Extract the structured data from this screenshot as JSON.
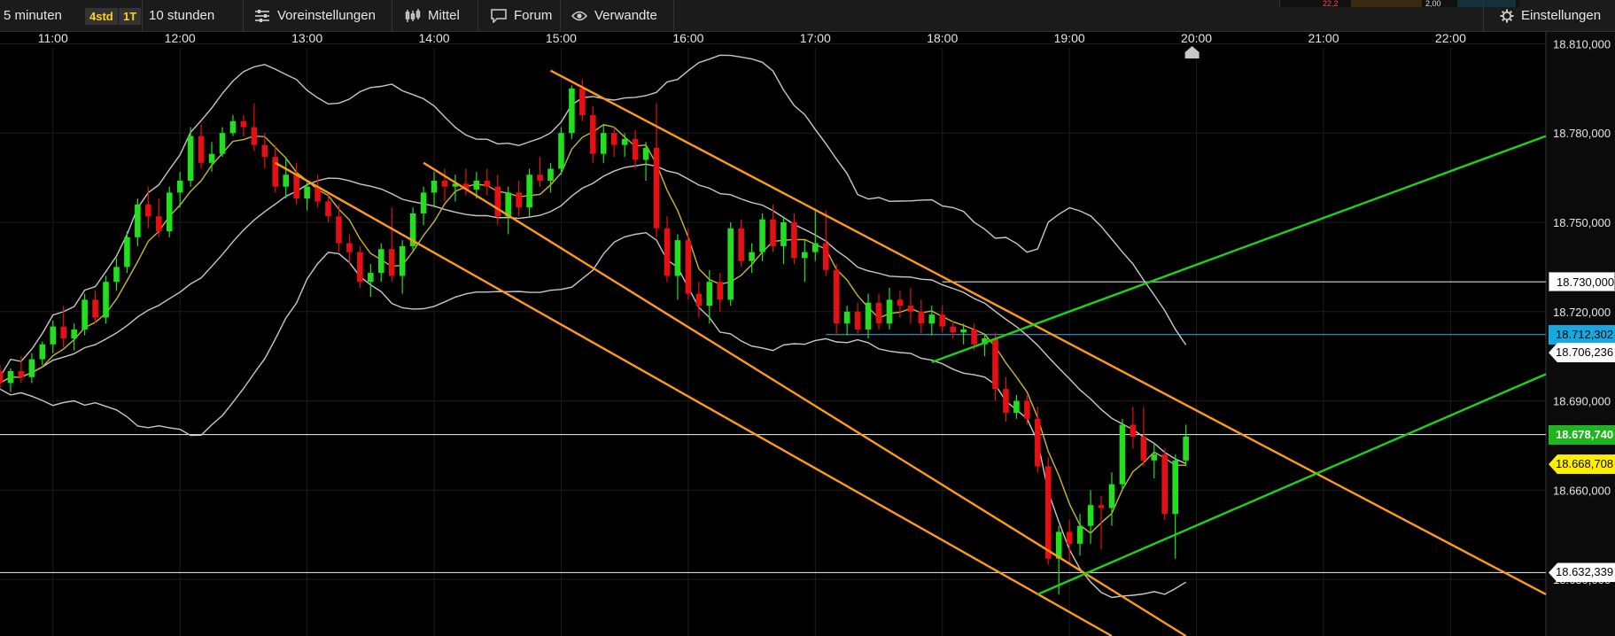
{
  "toolbar": {
    "interval": "5 minuten",
    "chip_range": "4std",
    "chip_day": "1T",
    "range": "10 stunden",
    "presets": "Voreinstellungen",
    "indicators": "Mittel",
    "forum": "Forum",
    "related": "Verwandte",
    "settings": "Einstellungen",
    "strip_red": "22,2",
    "strip_val": "2,00",
    "icons": [
      "sliders-icon",
      "candle-chart-icon",
      "speech-bubble-icon",
      "eye-icon",
      "gear-icon"
    ]
  },
  "colors": {
    "up": "#22e01e",
    "down": "#e60f14",
    "orange": "#ff9a1a",
    "green": "#1ed219",
    "bollinger": "#c8c8c8",
    "sma": "#c7b830",
    "blue_line": "#1ba0d4",
    "last_price_box": "#1fb51f",
    "yellow_box": "#ffee00",
    "blue_box": "#18a8e0"
  },
  "chart_data": {
    "type": "candlestick",
    "x_ticks": [
      "11:00",
      "12:00",
      "13:00",
      "14:00",
      "15:00",
      "16:00",
      "17:00",
      "18:00",
      "19:00",
      "20:00",
      "21:00",
      "22:00"
    ],
    "y_ticks": [
      "18.810,000",
      "18.780,000",
      "18.750,000",
      "18.720,000",
      "18.690,000",
      "18.660,000",
      "18.630,000"
    ],
    "y_tick_values": [
      18810,
      18780,
      18750,
      18720,
      18690,
      18660,
      18630
    ],
    "x_start": "10:35",
    "x_end": "22:45",
    "y_range": [
      18611,
      18814
    ],
    "markers": [
      {
        "label": "18.730,000",
        "value": 18730,
        "style": "white"
      },
      {
        "label": "18.712,302",
        "value": 18712.3,
        "style": "blue"
      },
      {
        "label": "18.706,236",
        "value": 18706.2,
        "style": "white-tag"
      },
      {
        "label": "18.678,740",
        "value": 18678.7,
        "style": "green"
      },
      {
        "label": "18.668,708",
        "value": 18668.7,
        "style": "yellow"
      },
      {
        "label": "18.632,339",
        "value": 18632.3,
        "style": "white-tag"
      }
    ],
    "horizontal_lines": [
      {
        "value": 18730,
        "from": "18:00",
        "color": "white"
      },
      {
        "value": 18712.3,
        "from": "17:05",
        "color": "blue"
      },
      {
        "value": 18678.7,
        "from": "10:35",
        "color": "white"
      },
      {
        "value": 18632.3,
        "from": "10:35",
        "color": "white"
      }
    ],
    "trend_lines": [
      {
        "color": "orange",
        "from": [
          "14:55",
          18801
        ],
        "to": [
          "22:45",
          18625
        ]
      },
      {
        "color": "orange",
        "from": [
          "12:45",
          18770
        ],
        "to": [
          "19:20",
          18611
        ]
      },
      {
        "color": "orange",
        "from": [
          "13:55",
          18770
        ],
        "to": [
          "19:55",
          18611
        ]
      },
      {
        "color": "green",
        "from": [
          "17:55",
          18703
        ],
        "to": [
          "22:45",
          18779
        ]
      },
      {
        "color": "green",
        "from": [
          "18:45",
          18625
        ],
        "to": [
          "22:45",
          18699
        ]
      }
    ],
    "candles": [
      {
        "t": "10:35",
        "o": 18700,
        "h": 18702,
        "l": 18694,
        "c": 18696
      },
      {
        "t": "10:40",
        "o": 18696,
        "h": 18701,
        "l": 18693,
        "c": 18700
      },
      {
        "t": "10:45",
        "o": 18700,
        "h": 18705,
        "l": 18696,
        "c": 18698
      },
      {
        "t": "10:50",
        "o": 18698,
        "h": 18706,
        "l": 18696,
        "c": 18704
      },
      {
        "t": "10:55",
        "o": 18704,
        "h": 18710,
        "l": 18702,
        "c": 18709
      },
      {
        "t": "11:00",
        "o": 18709,
        "h": 18717,
        "l": 18706,
        "c": 18715
      },
      {
        "t": "11:05",
        "o": 18715,
        "h": 18722,
        "l": 18708,
        "c": 18711
      },
      {
        "t": "11:10",
        "o": 18711,
        "h": 18716,
        "l": 18707,
        "c": 18714
      },
      {
        "t": "11:15",
        "o": 18714,
        "h": 18726,
        "l": 18712,
        "c": 18724
      },
      {
        "t": "11:20",
        "o": 18724,
        "h": 18727,
        "l": 18716,
        "c": 18718
      },
      {
        "t": "11:25",
        "o": 18718,
        "h": 18732,
        "l": 18716,
        "c": 18730
      },
      {
        "t": "11:30",
        "o": 18730,
        "h": 18738,
        "l": 18727,
        "c": 18735
      },
      {
        "t": "11:35",
        "o": 18735,
        "h": 18747,
        "l": 18733,
        "c": 18745
      },
      {
        "t": "11:40",
        "o": 18745,
        "h": 18758,
        "l": 18742,
        "c": 18756
      },
      {
        "t": "11:45",
        "o": 18756,
        "h": 18762,
        "l": 18748,
        "c": 18752
      },
      {
        "t": "11:50",
        "o": 18752,
        "h": 18758,
        "l": 18745,
        "c": 18747
      },
      {
        "t": "11:55",
        "o": 18747,
        "h": 18762,
        "l": 18745,
        "c": 18760
      },
      {
        "t": "12:00",
        "o": 18760,
        "h": 18767,
        "l": 18755,
        "c": 18764
      },
      {
        "t": "12:05",
        "o": 18764,
        "h": 18782,
        "l": 18762,
        "c": 18779
      },
      {
        "t": "12:10",
        "o": 18779,
        "h": 18783,
        "l": 18768,
        "c": 18770
      },
      {
        "t": "12:15",
        "o": 18770,
        "h": 18777,
        "l": 18767,
        "c": 18773
      },
      {
        "t": "12:20",
        "o": 18773,
        "h": 18782,
        "l": 18772,
        "c": 18780
      },
      {
        "t": "12:25",
        "o": 18780,
        "h": 18786,
        "l": 18779,
        "c": 18784
      },
      {
        "t": "12:30",
        "o": 18784,
        "h": 18786,
        "l": 18779,
        "c": 18782
      },
      {
        "t": "12:35",
        "o": 18782,
        "h": 18790,
        "l": 18774,
        "c": 18776
      },
      {
        "t": "12:40",
        "o": 18776,
        "h": 18780,
        "l": 18768,
        "c": 18772
      },
      {
        "t": "12:45",
        "o": 18772,
        "h": 18776,
        "l": 18760,
        "c": 18762
      },
      {
        "t": "12:50",
        "o": 18762,
        "h": 18772,
        "l": 18758,
        "c": 18766
      },
      {
        "t": "12:55",
        "o": 18766,
        "h": 18770,
        "l": 18756,
        "c": 18758
      },
      {
        "t": "13:00",
        "o": 18758,
        "h": 18764,
        "l": 18754,
        "c": 18762
      },
      {
        "t": "13:05",
        "o": 18762,
        "h": 18766,
        "l": 18755,
        "c": 18757
      },
      {
        "t": "13:10",
        "o": 18757,
        "h": 18760,
        "l": 18750,
        "c": 18752
      },
      {
        "t": "13:15",
        "o": 18752,
        "h": 18756,
        "l": 18740,
        "c": 18743
      },
      {
        "t": "13:20",
        "o": 18743,
        "h": 18746,
        "l": 18736,
        "c": 18740
      },
      {
        "t": "13:25",
        "o": 18740,
        "h": 18742,
        "l": 18728,
        "c": 18730
      },
      {
        "t": "13:30",
        "o": 18730,
        "h": 18736,
        "l": 18725,
        "c": 18733
      },
      {
        "t": "13:35",
        "o": 18733,
        "h": 18743,
        "l": 18730,
        "c": 18741
      },
      {
        "t": "13:40",
        "o": 18741,
        "h": 18755,
        "l": 18730,
        "c": 18732
      },
      {
        "t": "13:45",
        "o": 18732,
        "h": 18744,
        "l": 18726,
        "c": 18742
      },
      {
        "t": "13:50",
        "o": 18742,
        "h": 18755,
        "l": 18740,
        "c": 18753
      },
      {
        "t": "13:55",
        "o": 18753,
        "h": 18762,
        "l": 18749,
        "c": 18760
      },
      {
        "t": "14:00",
        "o": 18760,
        "h": 18767,
        "l": 18755,
        "c": 18764
      },
      {
        "t": "14:05",
        "o": 18764,
        "h": 18768,
        "l": 18757,
        "c": 18762
      },
      {
        "t": "14:10",
        "o": 18762,
        "h": 18766,
        "l": 18757,
        "c": 18763
      },
      {
        "t": "14:15",
        "o": 18763,
        "h": 18768,
        "l": 18759,
        "c": 18761
      },
      {
        "t": "14:20",
        "o": 18761,
        "h": 18767,
        "l": 18758,
        "c": 18764
      },
      {
        "t": "14:25",
        "o": 18764,
        "h": 18768,
        "l": 18759,
        "c": 18762
      },
      {
        "t": "14:30",
        "o": 18762,
        "h": 18766,
        "l": 18749,
        "c": 18752
      },
      {
        "t": "14:35",
        "o": 18752,
        "h": 18762,
        "l": 18746,
        "c": 18760
      },
      {
        "t": "14:40",
        "o": 18760,
        "h": 18764,
        "l": 18752,
        "c": 18755
      },
      {
        "t": "14:45",
        "o": 18755,
        "h": 18768,
        "l": 18752,
        "c": 18766
      },
      {
        "t": "14:50",
        "o": 18766,
        "h": 18772,
        "l": 18762,
        "c": 18764
      },
      {
        "t": "14:55",
        "o": 18764,
        "h": 18770,
        "l": 18760,
        "c": 18768
      },
      {
        "t": "15:00",
        "o": 18768,
        "h": 18782,
        "l": 18766,
        "c": 18780
      },
      {
        "t": "15:05",
        "o": 18780,
        "h": 18796,
        "l": 18778,
        "c": 18795
      },
      {
        "t": "15:10",
        "o": 18795,
        "h": 18798,
        "l": 18784,
        "c": 18786
      },
      {
        "t": "15:15",
        "o": 18786,
        "h": 18789,
        "l": 18770,
        "c": 18773
      },
      {
        "t": "15:20",
        "o": 18773,
        "h": 18783,
        "l": 18770,
        "c": 18780
      },
      {
        "t": "15:25",
        "o": 18780,
        "h": 18782,
        "l": 18772,
        "c": 18776
      },
      {
        "t": "15:30",
        "o": 18776,
        "h": 18780,
        "l": 18772,
        "c": 18778
      },
      {
        "t": "15:35",
        "o": 18778,
        "h": 18781,
        "l": 18768,
        "c": 18771
      },
      {
        "t": "15:40",
        "o": 18771,
        "h": 18777,
        "l": 18764,
        "c": 18775
      },
      {
        "t": "15:45",
        "o": 18775,
        "h": 18790,
        "l": 18745,
        "c": 18748
      },
      {
        "t": "15:50",
        "o": 18748,
        "h": 18752,
        "l": 18730,
        "c": 18732
      },
      {
        "t": "15:55",
        "o": 18732,
        "h": 18746,
        "l": 18724,
        "c": 18744
      },
      {
        "t": "16:00",
        "o": 18744,
        "h": 18748,
        "l": 18724,
        "c": 18726
      },
      {
        "t": "16:05",
        "o": 18726,
        "h": 18730,
        "l": 18718,
        "c": 18722
      },
      {
        "t": "16:10",
        "o": 18722,
        "h": 18734,
        "l": 18716,
        "c": 18730
      },
      {
        "t": "16:15",
        "o": 18730,
        "h": 18733,
        "l": 18720,
        "c": 18724
      },
      {
        "t": "16:20",
        "o": 18724,
        "h": 18750,
        "l": 18722,
        "c": 18748
      },
      {
        "t": "16:25",
        "o": 18748,
        "h": 18751,
        "l": 18735,
        "c": 18737
      },
      {
        "t": "16:30",
        "o": 18737,
        "h": 18743,
        "l": 18733,
        "c": 18740
      },
      {
        "t": "16:35",
        "o": 18740,
        "h": 18753,
        "l": 18737,
        "c": 18751
      },
      {
        "t": "16:40",
        "o": 18751,
        "h": 18756,
        "l": 18740,
        "c": 18742
      },
      {
        "t": "16:45",
        "o": 18742,
        "h": 18752,
        "l": 18736,
        "c": 18750
      },
      {
        "t": "16:50",
        "o": 18750,
        "h": 18753,
        "l": 18736,
        "c": 18738
      },
      {
        "t": "16:55",
        "o": 18738,
        "h": 18744,
        "l": 18730,
        "c": 18740
      },
      {
        "t": "17:00",
        "o": 18740,
        "h": 18754,
        "l": 18737,
        "c": 18743
      },
      {
        "t": "17:05",
        "o": 18743,
        "h": 18754,
        "l": 18732,
        "c": 18734
      },
      {
        "t": "17:10",
        "o": 18734,
        "h": 18736,
        "l": 18712,
        "c": 18716
      },
      {
        "t": "17:15",
        "o": 18716,
        "h": 18722,
        "l": 18712,
        "c": 18720
      },
      {
        "t": "17:20",
        "o": 18720,
        "h": 18723,
        "l": 18712,
        "c": 18714
      },
      {
        "t": "17:25",
        "o": 18714,
        "h": 18726,
        "l": 18711,
        "c": 18723
      },
      {
        "t": "17:30",
        "o": 18723,
        "h": 18726,
        "l": 18714,
        "c": 18716
      },
      {
        "t": "17:35",
        "o": 18716,
        "h": 18728,
        "l": 18714,
        "c": 18724
      },
      {
        "t": "17:40",
        "o": 18724,
        "h": 18727,
        "l": 18718,
        "c": 18722
      },
      {
        "t": "17:45",
        "o": 18722,
        "h": 18728,
        "l": 18716,
        "c": 18720
      },
      {
        "t": "17:50",
        "o": 18720,
        "h": 18724,
        "l": 18712,
        "c": 18716
      },
      {
        "t": "17:55",
        "o": 18716,
        "h": 18722,
        "l": 18712,
        "c": 18719
      },
      {
        "t": "18:00",
        "o": 18719,
        "h": 18722,
        "l": 18713,
        "c": 18715
      },
      {
        "t": "18:05",
        "o": 18715,
        "h": 18717,
        "l": 18711,
        "c": 18713
      },
      {
        "t": "18:10",
        "o": 18713,
        "h": 18716,
        "l": 18709,
        "c": 18714
      },
      {
        "t": "18:15",
        "o": 18714,
        "h": 18716,
        "l": 18707,
        "c": 18709
      },
      {
        "t": "18:20",
        "o": 18709,
        "h": 18712,
        "l": 18705,
        "c": 18711
      },
      {
        "t": "18:25",
        "o": 18711,
        "h": 18713,
        "l": 18690,
        "c": 18694
      },
      {
        "t": "18:30",
        "o": 18694,
        "h": 18698,
        "l": 18683,
        "c": 18686
      },
      {
        "t": "18:35",
        "o": 18686,
        "h": 18692,
        "l": 18684,
        "c": 18690
      },
      {
        "t": "18:40",
        "o": 18690,
        "h": 18692,
        "l": 18682,
        "c": 18684
      },
      {
        "t": "18:45",
        "o": 18684,
        "h": 18688,
        "l": 18666,
        "c": 18668
      },
      {
        "t": "18:50",
        "o": 18668,
        "h": 18671,
        "l": 18635,
        "c": 18637
      },
      {
        "t": "18:55",
        "o": 18637,
        "h": 18648,
        "l": 18625,
        "c": 18646
      },
      {
        "t": "19:00",
        "o": 18646,
        "h": 18650,
        "l": 18635,
        "c": 18642
      },
      {
        "t": "19:05",
        "o": 18642,
        "h": 18652,
        "l": 18638,
        "c": 18648
      },
      {
        "t": "19:10",
        "o": 18648,
        "h": 18660,
        "l": 18642,
        "c": 18655
      },
      {
        "t": "19:15",
        "o": 18655,
        "h": 18658,
        "l": 18640,
        "c": 18654
      },
      {
        "t": "19:20",
        "o": 18654,
        "h": 18666,
        "l": 18648,
        "c": 18662
      },
      {
        "t": "19:25",
        "o": 18662,
        "h": 18684,
        "l": 18660,
        "c": 18682
      },
      {
        "t": "19:30",
        "o": 18682,
        "h": 18688,
        "l": 18674,
        "c": 18678
      },
      {
        "t": "19:35",
        "o": 18678,
        "h": 18688,
        "l": 18668,
        "c": 18670
      },
      {
        "t": "19:40",
        "o": 18670,
        "h": 18676,
        "l": 18664,
        "c": 18672
      },
      {
        "t": "19:45",
        "o": 18672,
        "h": 18674,
        "l": 18650,
        "c": 18652
      },
      {
        "t": "19:50",
        "o": 18652,
        "h": 18672,
        "l": 18637,
        "c": 18670
      },
      {
        "t": "19:55",
        "o": 18670,
        "h": 18682,
        "l": 18668,
        "c": 18678
      }
    ]
  }
}
